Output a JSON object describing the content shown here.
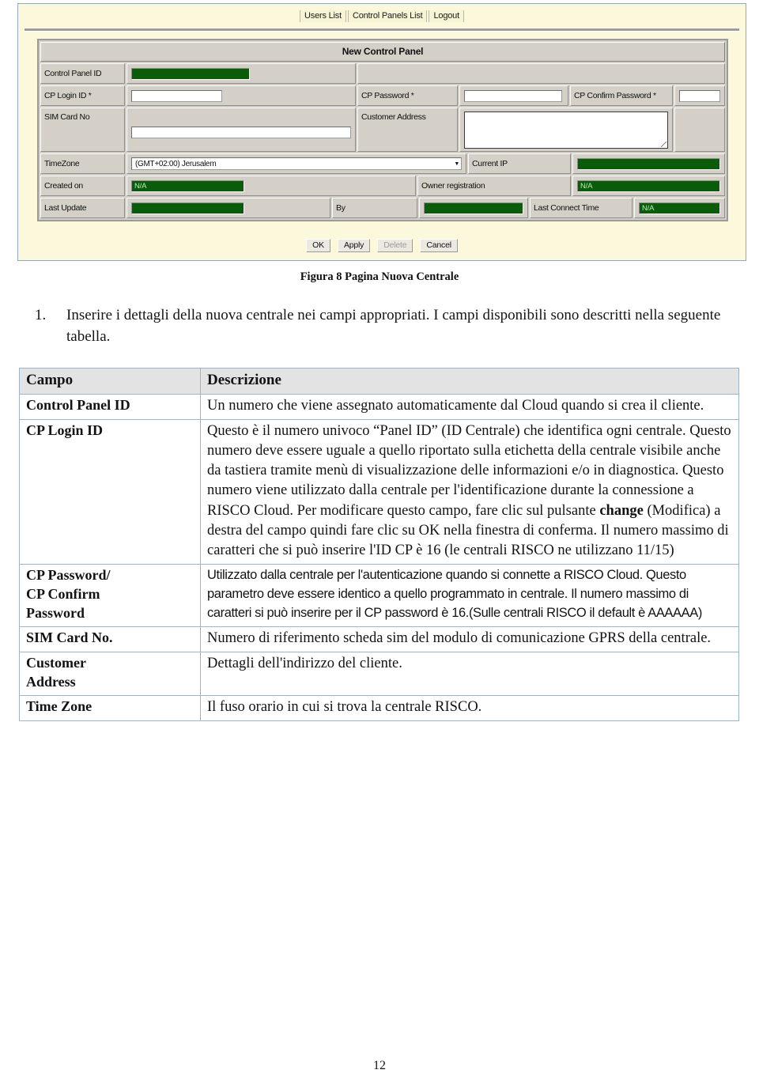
{
  "screenshot": {
    "nav": [
      {
        "label": "Users List",
        "name": "users-list"
      },
      {
        "label": "Control Panels List",
        "name": "control-panels-list"
      },
      {
        "label": "Logout",
        "name": "logout"
      }
    ],
    "panel_title": "New Control Panel",
    "fields": {
      "control_panel_id_label": "Control Panel ID",
      "control_panel_id_value": "",
      "cp_login_id_label": "CP Login ID *",
      "cp_login_id_value": "",
      "cp_password_label": "CP Password *",
      "cp_password_value": "",
      "cp_confirm_password_label": "CP Confirm Password *",
      "cp_confirm_password_value": "",
      "sim_card_no_label": "SIM Card No",
      "sim_card_no_value": "",
      "customer_address_label": "Customer Address",
      "customer_address_value": "",
      "timezone_label": "TimeZone",
      "timezone_value": "(GMT+02:00) Jerusalem",
      "timezone_caret": "▼",
      "current_ip_label": "Current IP",
      "current_ip_value": "",
      "created_on_label": "Created on",
      "created_on_value": "N/A",
      "owner_registration_label": "Owner registration",
      "owner_registration_value": "N/A",
      "last_update_label": "Last Update",
      "last_update_value": "",
      "by_label": "By",
      "by_value": "",
      "last_connect_time_label": "Last Connect Time",
      "last_connect_time_value": "N/A"
    },
    "buttons": [
      {
        "label": "OK",
        "name": "ok-button",
        "disabled": false
      },
      {
        "label": "Apply",
        "name": "apply-button",
        "disabled": false
      },
      {
        "label": "Delete",
        "name": "delete-button",
        "disabled": true
      },
      {
        "label": "Cancel",
        "name": "cancel-button",
        "disabled": false
      }
    ],
    "colors": {
      "page_background": "#fbf8dc",
      "form_background": "#d4d0c8",
      "value_field_green": "#0a5c0a",
      "border": "#8fa8c8"
    }
  },
  "figure_caption": "Figura 8 Pagina Nuova Centrale",
  "step": {
    "number": "1.",
    "text": "Inserire i dettagli della nuova centrale nei campi appropriati. I campi disponibili sono descritti nella seguente tabella."
  },
  "table": {
    "headers": [
      "Campo",
      "Descrizione"
    ],
    "rows": [
      {
        "field": "Control Panel ID",
        "description": "Un numero che viene assegnato automaticamente dal Cloud quando si crea il cliente.",
        "style": "serif"
      },
      {
        "field": "CP Login ID",
        "description_part1": "Questo è il numero univoco “Panel ID” (ID Centrale)  che identifica ogni centrale. Questo numero deve essere uguale a quello riportato sulla etichetta della centrale visibile anche da tastiera tramite menù di visualizzazione delle informazioni e/o in diagnostica. Questo numero viene utilizzato dalla centrale per l'identificazione durante la connessione a RISCO Cloud. Per modificare questo campo, fare clic sul pulsante ",
        "description_bold": "change",
        "description_part2": " (Modifica) a destra del campo quindi fare clic su OK nella finestra di conferma. Il numero massimo di caratteri che si può inserire l'ID CP è 16 (le centrali RISCO ne utilizzano 11/15)",
        "style": "serif"
      },
      {
        "field": "CP Password/ CP Confirm Password",
        "field_line1": "CP Password/",
        "field_line2": "CP Confirm",
        "field_line3": "Password",
        "description": "Utilizzato dalla centrale per l'autenticazione quando si connette a RISCO Cloud. Questo parametro deve essere identico a quello programmato in centrale. Il numero massimo di caratteri si può inserire per il CP password è 16.(Sulle centrali RISCO il default è AAAAAA)",
        "style": "sans"
      },
      {
        "field": "SIM Card No.",
        "description": "Numero di riferimento scheda sim del modulo di comunicazione GPRS della centrale.",
        "style": "serif"
      },
      {
        "field": "Customer Address",
        "field_line1": "Customer",
        "field_line2": "Address",
        "description": "Dettagli dell'indirizzo del cliente.",
        "style": "serif"
      },
      {
        "field": "Time Zone",
        "description": "Il fuso orario in cui si trova la centrale RISCO.",
        "style": "serif"
      }
    ]
  },
  "page_number": "12"
}
